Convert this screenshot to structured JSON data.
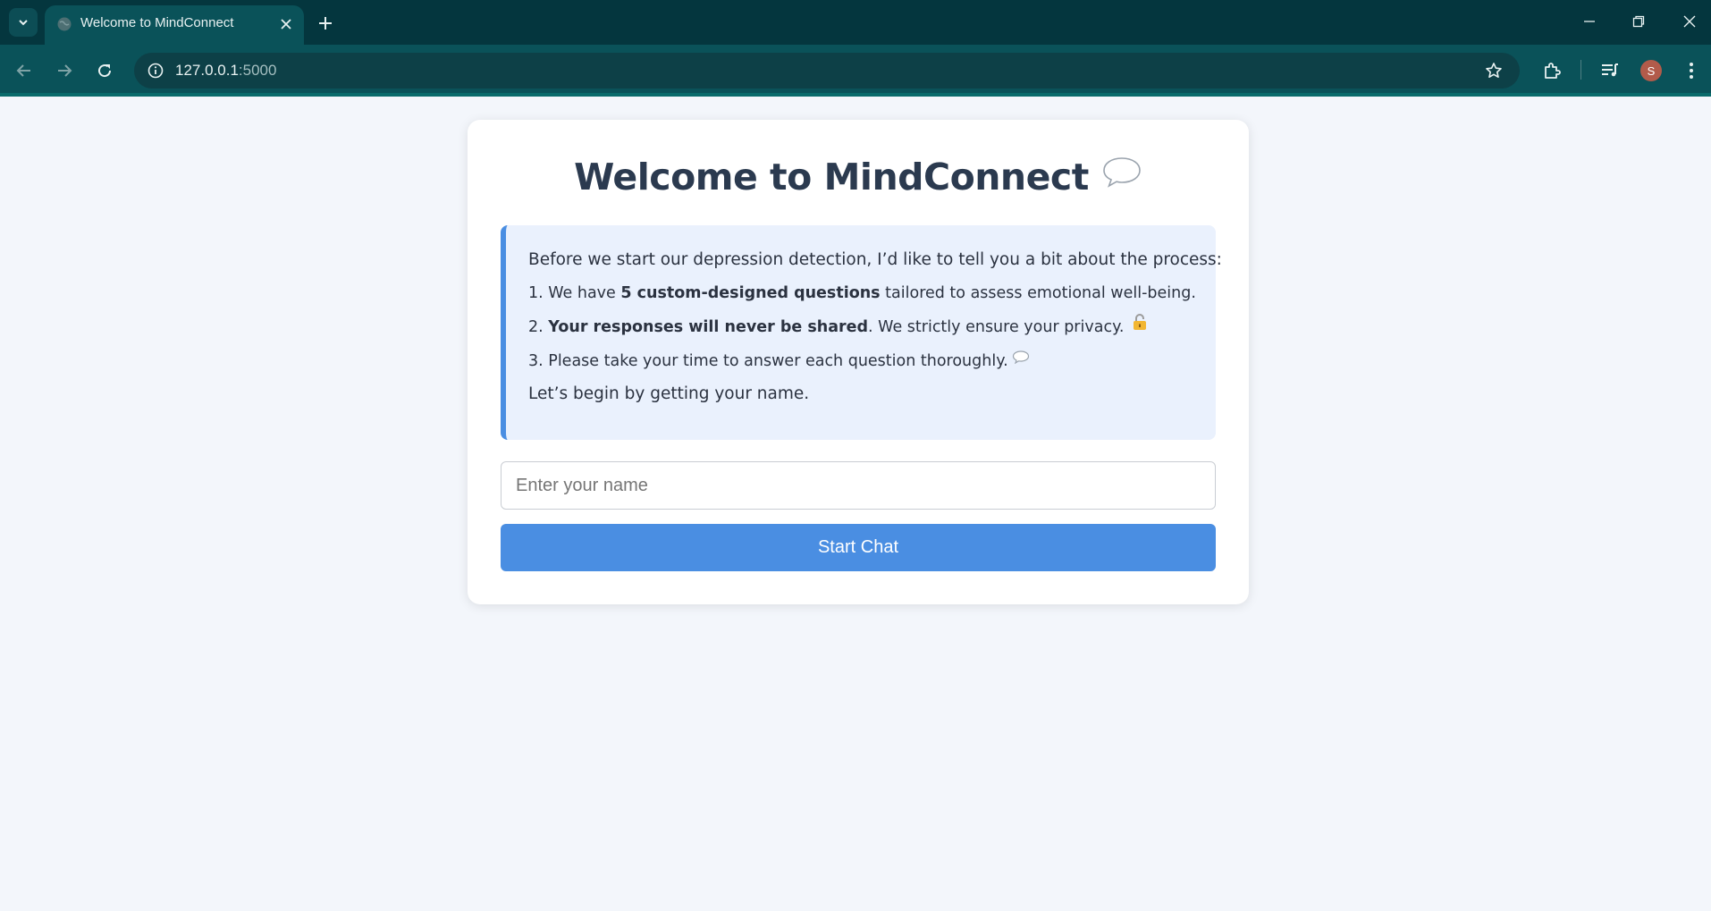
{
  "browser": {
    "tab": {
      "title": "Welcome to MindConnect"
    },
    "url": {
      "host": "127.0.0.1",
      "port": ":5000"
    },
    "profile_initial": "S"
  },
  "page": {
    "title": "Welcome to MindConnect",
    "title_icon": "speech-bubble-icon",
    "intro": {
      "lead": "Before we start our depression detection, I’d like to tell you a bit about the process:",
      "item1": {
        "prefix": "1. We have ",
        "bold": "5 custom-designed questions",
        "suffix": " tailored to assess emotional well-being."
      },
      "item2": {
        "prefix": "2. ",
        "bold": "Your responses will never be shared",
        "suffix": ". We strictly ensure your privacy.",
        "icon": "lock-icon"
      },
      "item3": {
        "text": "3. Please take your time to answer each question thoroughly.",
        "icon": "speech-bubble-icon"
      },
      "closing": "Let’s begin by getting your name."
    },
    "name_input": {
      "placeholder": "Enter your name",
      "value": ""
    },
    "start_button": {
      "label": "Start Chat"
    }
  },
  "colors": {
    "browser_frame": "#04363e",
    "toolbar": "#0a5259",
    "page_background": "#f3f6fb",
    "accent": "#4a8ee2",
    "info_background": "#eaf1fd",
    "title_text": "#2b3a4f"
  }
}
